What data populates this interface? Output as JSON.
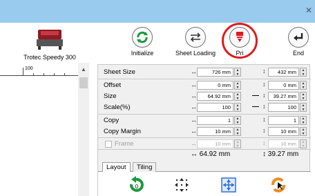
{
  "window": {
    "close_glyph": "✕"
  },
  "machine": {
    "name": "Trotec Speedy 300"
  },
  "toolbar": {
    "initialize": "Initialize",
    "sheet_loading": "Sheet Loading",
    "print": "Pri",
    "end": "End"
  },
  "ruler": {
    "label": "100"
  },
  "panel": {
    "sheet_size": {
      "label": "Sheet Size",
      "width": "726 mm",
      "height": "432 mm"
    },
    "offset": {
      "label": "Offset",
      "x": "0 mm",
      "y": "0 mm"
    },
    "size": {
      "label": "Size",
      "width": "64.92 mm",
      "height": "39.27 mm"
    },
    "scale": {
      "label": "Scale(%)",
      "x": "100",
      "y": "100"
    },
    "copy": {
      "label": "Copy",
      "x": "1",
      "y": "1"
    },
    "copy_margin": {
      "label": "Copy Margin",
      "x": "10 mm",
      "y": "10 mm"
    },
    "frame": {
      "label": "Frame",
      "x": "10 mm",
      "y": "10 mm"
    },
    "total": {
      "width": "↔ 64.92 mm",
      "height": "↕ 39.27 mm"
    }
  },
  "tabs": {
    "layout": "Layout",
    "tiling": "Tiling",
    "rotate_count": "0"
  },
  "colors": {
    "titlebar": "#99cbee",
    "accent_green": "#1a9a3c",
    "accent_red": "#e11a1a",
    "accent_blue": "#2a6fd6",
    "accent_orange": "#f08a1c"
  }
}
